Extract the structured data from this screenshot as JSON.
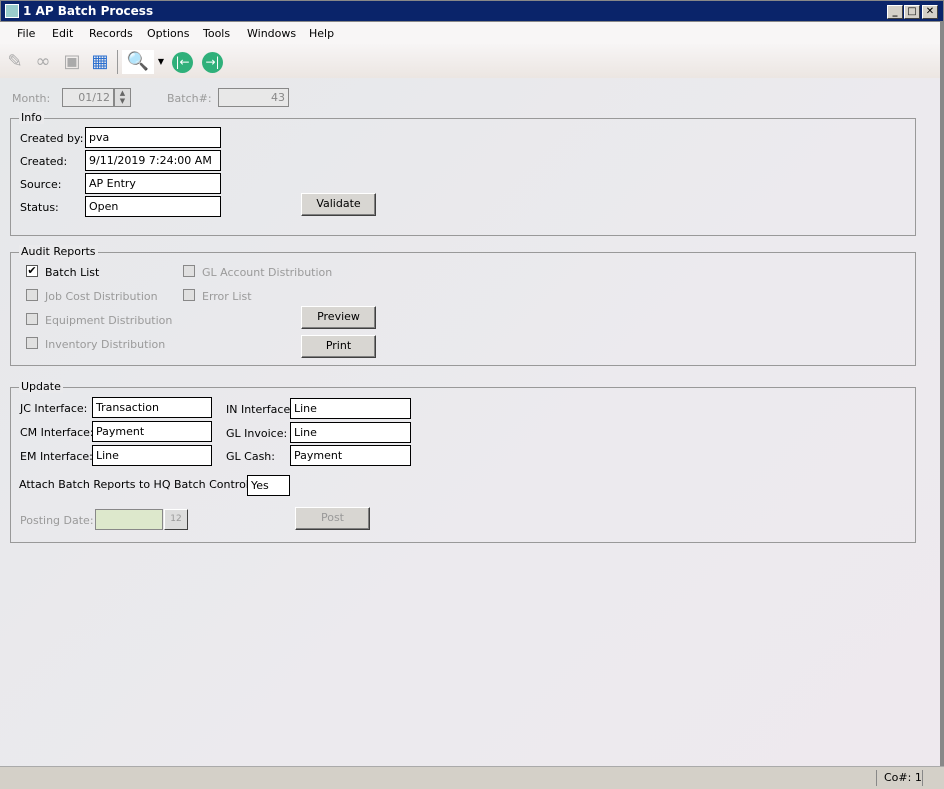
{
  "window": {
    "title": "1 AP Batch Process",
    "minimize": "_",
    "maximize": "□",
    "close": "✕"
  },
  "menu": [
    "File",
    "Edit",
    "Records",
    "Options",
    "Tools",
    "Windows",
    "Help"
  ],
  "toolbar": {
    "icons": [
      "post-note-icon",
      "binoculars-icon",
      "box-icon",
      "calculator-icon",
      "print-preview-icon",
      "dropdown-arrow-icon",
      "first-record-icon",
      "last-record-icon"
    ]
  },
  "header": {
    "month_label": "Month:",
    "month_value": "01/12",
    "batch_label": "Batch#:",
    "batch_value": "43"
  },
  "info": {
    "title": "Info",
    "created_by_label": "Created by:",
    "created_by": "pva",
    "created_label": "Created:",
    "created": "9/11/2019 7:24:00 AM",
    "source_label": "Source:",
    "source": "AP Entry",
    "status_label": "Status:",
    "status": "Open",
    "validate": "Validate"
  },
  "audit": {
    "title": "Audit Reports",
    "items": [
      {
        "label": "Batch List",
        "checked": true,
        "enabled": true
      },
      {
        "label": "GL Account Distribution",
        "checked": false,
        "enabled": false
      },
      {
        "label": "Job Cost Distribution",
        "checked": false,
        "enabled": false
      },
      {
        "label": "Error List",
        "checked": false,
        "enabled": false
      },
      {
        "label": "Equipment Distribution",
        "checked": false,
        "enabled": false
      },
      {
        "label": "Inventory Distribution",
        "checked": false,
        "enabled": false
      }
    ],
    "preview": "Preview",
    "print": "Print"
  },
  "update": {
    "title": "Update",
    "jc_label": "JC Interface:",
    "jc": "Transaction",
    "cm_label": "CM Interface:",
    "cm": "Payment",
    "em_label": "EM Interface:",
    "em": "Line",
    "in_label": "IN Interface:",
    "in": "Line",
    "gli_label": "GL Invoice:",
    "gli": "Line",
    "glc_label": "GL Cash:",
    "glc": "Payment",
    "attach_label": "Attach Batch Reports to HQ Batch Control:",
    "attach": "Yes",
    "posting_label": "Posting Date:",
    "posting": "",
    "calendar": "12",
    "post": "Post"
  },
  "status": {
    "company": "Co#: 1"
  }
}
